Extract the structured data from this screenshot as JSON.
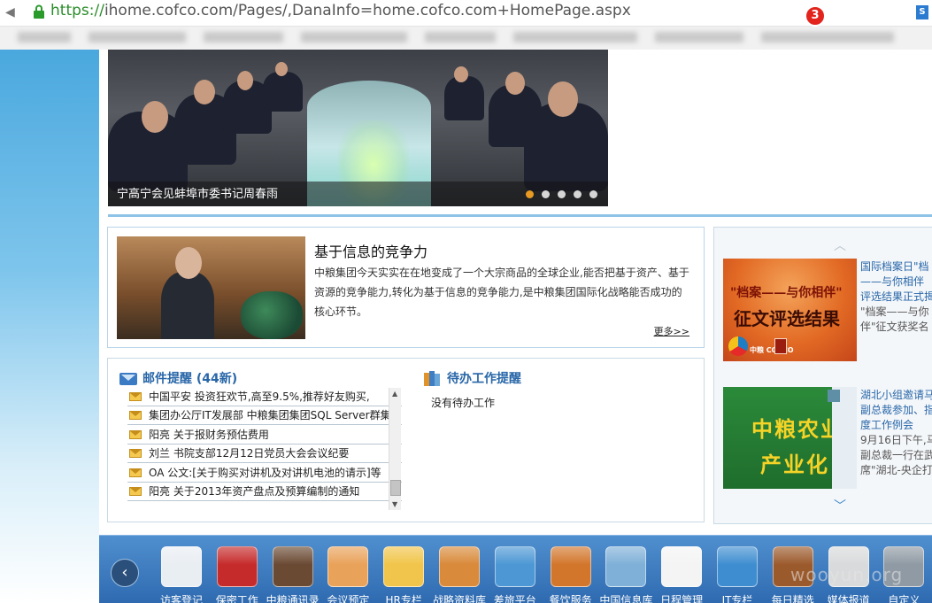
{
  "browser": {
    "url_proto": "https://",
    "url_rest": "ihome.cofco.com/Pages/,DanaInfo=home.cofco.com+HomePage.aspx",
    "extension_label": "S"
  },
  "hero": {
    "caption": "宁高宁会见蚌埠市委书记周春雨",
    "dots": [
      true,
      false,
      false,
      false,
      false
    ]
  },
  "feature": {
    "title": "基于信息的竞争力",
    "description": "中粮集团今天实实在在地变成了一个大宗商品的全球企业,能否把基于资产、基于资源的竞争能力,转化为基于信息的竞争能力,是中粮集团国际化战略能否成功的核心环节。",
    "more_label": "更多>>"
  },
  "sidebar": {
    "card1": {
      "image_line1": "\"档案——与你相伴\"",
      "image_line2": "征文评选结果",
      "logo_text": "中粮 COFCO",
      "lines": [
        {
          "text": "国际档案日\"档",
          "style": "lnk"
        },
        {
          "text": "——与你相伴",
          "style": "lnk"
        },
        {
          "text": "评选结果正式揭",
          "style": "lnk"
        },
        {
          "text": "\"档案——与你",
          "style": "gray"
        },
        {
          "text": "伴\"征文获奖名",
          "style": "gray"
        }
      ]
    },
    "card2": {
      "image_line1": "中粮农业",
      "image_line2": "产业化",
      "lines": [
        {
          "text": "湖北小组邀请马",
          "style": "lnk"
        },
        {
          "text": "副总裁参加、指",
          "style": "lnk"
        },
        {
          "text": "度工作例会",
          "style": "lnk"
        },
        {
          "text": "9月16日下午,马",
          "style": "gray"
        },
        {
          "text": "副总裁一行在武",
          "style": "gray"
        },
        {
          "text": "席\"湖北-央企打",
          "style": "gray"
        }
      ]
    }
  },
  "mail": {
    "title": "邮件提醒 (44新)",
    "items": [
      "中国平安 投资狂欢节,高至9.5%,推荐好友购买,",
      "集团办公厅IT发展部 中粮集团集团SQL Server群集",
      "阳亮 关于报财务预估费用",
      "刘兰 书院支部12月12日党员大会会议纪要",
      "OA 公文:[关于购买对讲机及对讲机电池的请示]等",
      "阳亮 关于2013年资产盘点及预算编制的通知"
    ]
  },
  "todo": {
    "title": "待办工作提醒",
    "empty": "没有待办工作"
  },
  "dock": {
    "prev_label": "‹",
    "badge": "3",
    "items": [
      {
        "label": "访客登记",
        "icon": "visitor-badge-icon",
        "color": "#e9eef3"
      },
      {
        "label": "保密工作",
        "icon": "confidential-seal-icon",
        "color": "#c62b2b"
      },
      {
        "label": "中粮通讯录",
        "icon": "address-book-icon",
        "color": "#6a4a33"
      },
      {
        "label": "会议预定",
        "icon": "meeting-people-icon",
        "color": "#e9a25a"
      },
      {
        "label": "HR专栏",
        "icon": "hr-card-icon",
        "color": "#f1c54b"
      },
      {
        "label": "战略资料库",
        "icon": "archive-box-icon",
        "color": "#d98a3a"
      },
      {
        "label": "差旅平台",
        "icon": "airplane-icon",
        "color": "#4c97d4"
      },
      {
        "label": "餐饮服务",
        "icon": "restaurant-icon",
        "color": "#d2762c"
      },
      {
        "label": "中国信息库",
        "icon": "binders-icon",
        "color": "#7fb0d8"
      },
      {
        "label": "日程管理",
        "icon": "calendar-icon",
        "color": "#f4f4f4"
      },
      {
        "label": "IT专栏",
        "icon": "it-network-icon",
        "color": "#3e8dd0"
      },
      {
        "label": "每日精选",
        "icon": "daily-book-icon",
        "color": "#9b5a2c"
      },
      {
        "label": "媒体报道",
        "icon": "media-player-icon",
        "color": "#d9dadb"
      },
      {
        "label": "自定义",
        "icon": "settings-gear-icon",
        "color": "#8f9aa4"
      }
    ]
  },
  "watermark": "wooyun.org"
}
